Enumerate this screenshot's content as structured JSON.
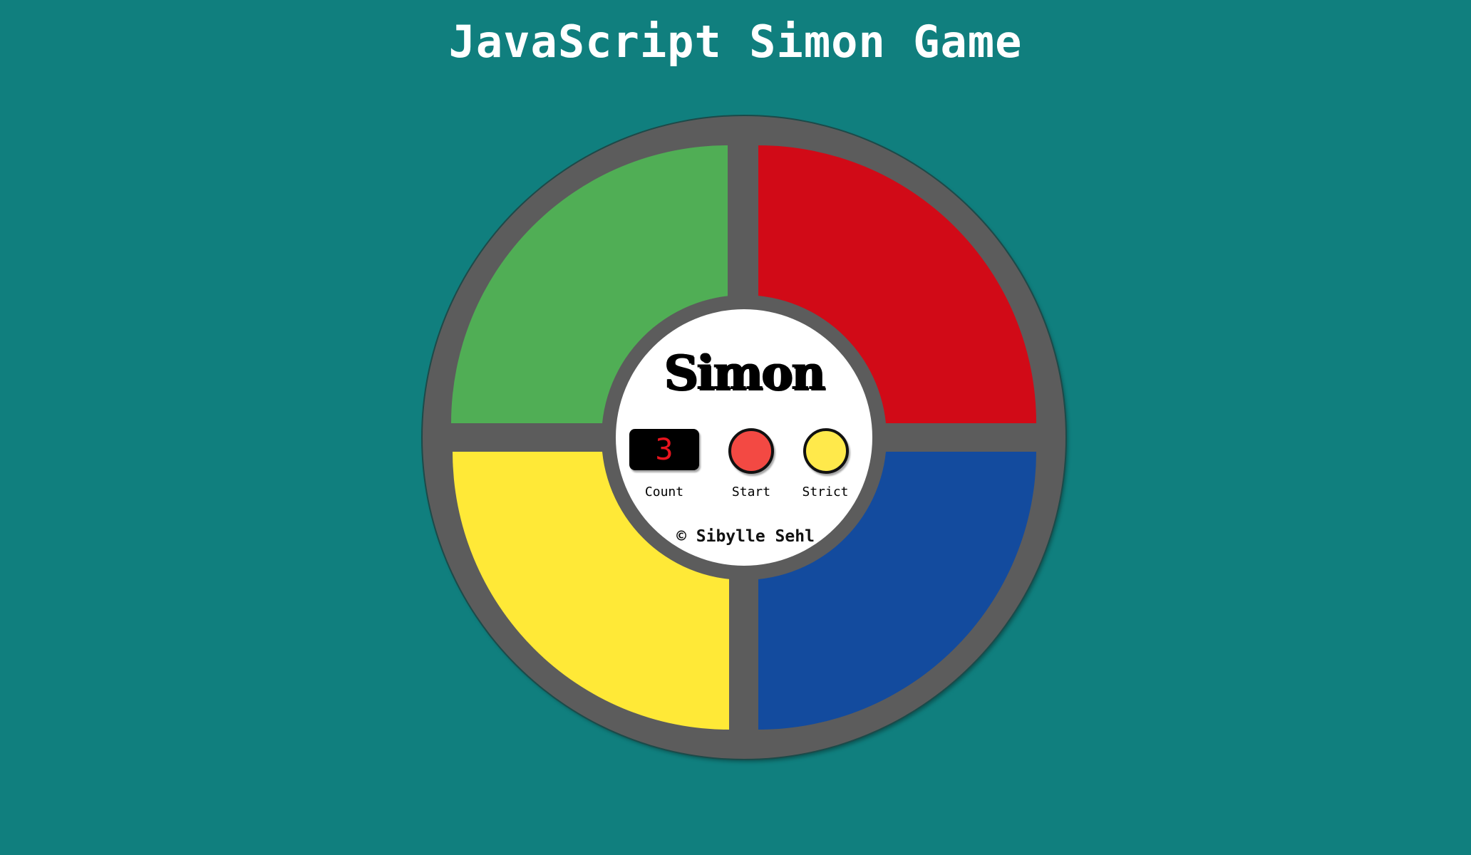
{
  "page": {
    "title": "JavaScript Simon Game",
    "background_color": "#107f7e"
  },
  "board": {
    "frame_color": "#5c5c5c",
    "pads": [
      {
        "id": "green",
        "color": "#50ae55"
      },
      {
        "id": "red",
        "color": "#d10a17"
      },
      {
        "id": "yellow",
        "color": "#ffe937"
      },
      {
        "id": "blue",
        "color": "#134b9e"
      }
    ]
  },
  "center": {
    "brand": "Simon",
    "count": {
      "value": "3",
      "label": "Count",
      "digit_color": "#e8141e"
    },
    "start": {
      "label": "Start",
      "color": "#f34943"
    },
    "strict": {
      "label": "Strict",
      "color": "#ffe94b"
    },
    "copyright": "© Sibylle Sehl"
  }
}
